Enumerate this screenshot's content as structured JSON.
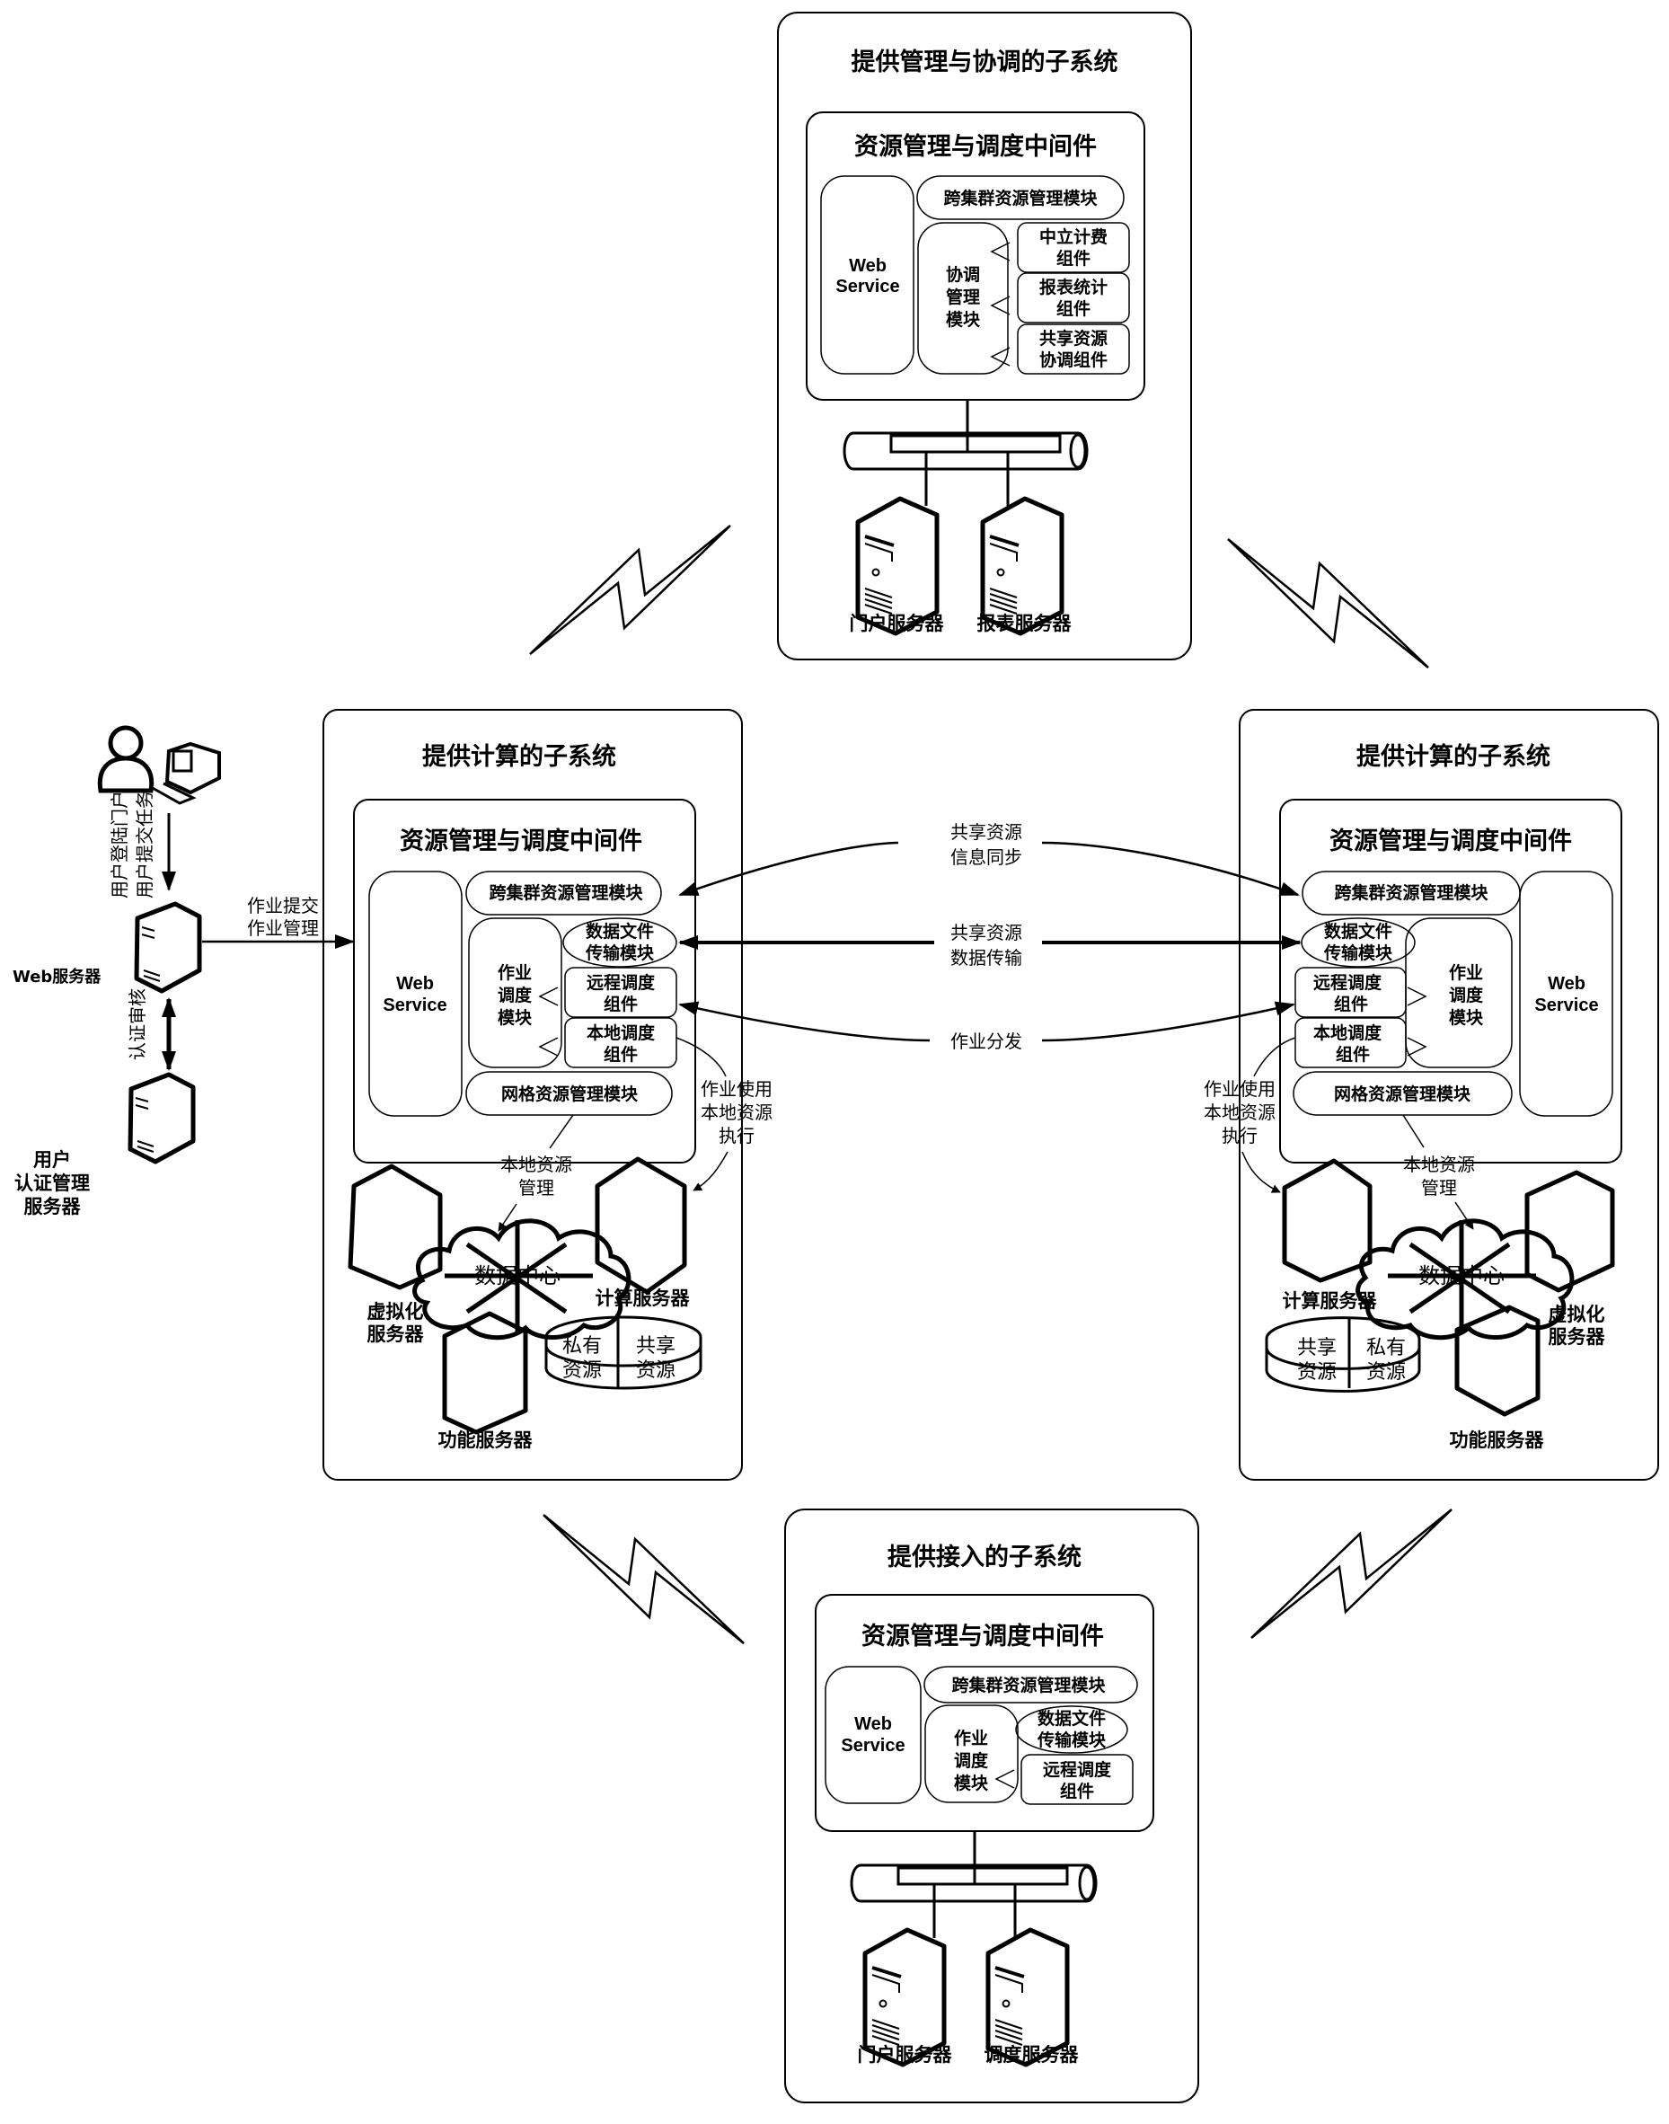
{
  "subsystems": {
    "top": {
      "title": "提供管理与协调的子系统",
      "middleware": "资源管理与调度中间件",
      "web_service": [
        "Web",
        "Service"
      ],
      "cross_cluster": "跨集群资源管理模块",
      "coord_module": [
        "协调",
        "管理",
        "模块"
      ],
      "components": [
        [
          "中立计费",
          "组件"
        ],
        [
          "报表统计",
          "组件"
        ],
        [
          "共享资源",
          "协调组件"
        ]
      ],
      "servers": [
        "门户服务器",
        "报表服务器"
      ]
    },
    "left": {
      "title": "提供计算的子系统",
      "middleware": "资源管理与调度中间件",
      "web_service": [
        "Web",
        "Service"
      ],
      "cross_cluster": "跨集群资源管理模块",
      "job_module": [
        "作业",
        "调度",
        "模块"
      ],
      "data_transfer": [
        "数据文件",
        "传输模块"
      ],
      "remote_sched": [
        "远程调度",
        "组件"
      ],
      "local_sched": [
        "本地调度",
        "组件"
      ],
      "grid_module": "网格资源管理模块",
      "local_mgmt": [
        "本地资源",
        "管理"
      ],
      "job_local": [
        "作业使用",
        "本地资源",
        "执行"
      ],
      "data_center": "数据中心",
      "virt_server": [
        "虚拟化",
        "服务器"
      ],
      "compute_server": "计算服务器",
      "func_server": "功能服务器",
      "storage": {
        "private": [
          "私有",
          "资源"
        ],
        "shared": [
          "共享",
          "资源"
        ]
      }
    },
    "right": {
      "title": "提供计算的子系统",
      "middleware": "资源管理与调度中间件",
      "web_service": [
        "Web",
        "Service"
      ],
      "cross_cluster": "跨集群资源管理模块",
      "job_module": [
        "作业",
        "调度",
        "模块"
      ],
      "data_transfer": [
        "数据文件",
        "传输模块"
      ],
      "remote_sched": [
        "远程调度",
        "组件"
      ],
      "local_sched": [
        "本地调度",
        "组件"
      ],
      "grid_module": "网格资源管理模块",
      "local_mgmt": [
        "本地资源",
        "管理"
      ],
      "job_local": [
        "作业使用",
        "本地资源",
        "执行"
      ],
      "data_center": "数据中心",
      "virt_server": [
        "虚拟化",
        "服务器"
      ],
      "compute_server": "计算服务器",
      "func_server": "功能服务器",
      "storage": {
        "private": [
          "私有",
          "资源"
        ],
        "shared": [
          "共享",
          "资源"
        ]
      }
    },
    "bottom": {
      "title": "提供接入的子系统",
      "middleware": "资源管理与调度中间件",
      "web_service": [
        "Web",
        "Service"
      ],
      "cross_cluster": "跨集群资源管理模块",
      "job_module": [
        "作业",
        "调度",
        "模块"
      ],
      "data_transfer": [
        "数据文件",
        "传输模块"
      ],
      "remote_sched": [
        "远程调度",
        "组件"
      ],
      "servers": [
        "门户服务器",
        "调度服务器"
      ]
    }
  },
  "links": {
    "sync": [
      "共享资源",
      "信息同步"
    ],
    "transfer": [
      "共享资源",
      "数据传输"
    ],
    "dispatch": "作业分发"
  },
  "user_side": {
    "login_label": "用户登陆门户",
    "submit_label": "用户提交任务",
    "web_server": "Web服务器",
    "job_submit": [
      "作业提交",
      "作业管理"
    ],
    "auth_label": "认证审核",
    "auth_server": [
      "用户",
      "认证管理",
      "服务器"
    ]
  }
}
